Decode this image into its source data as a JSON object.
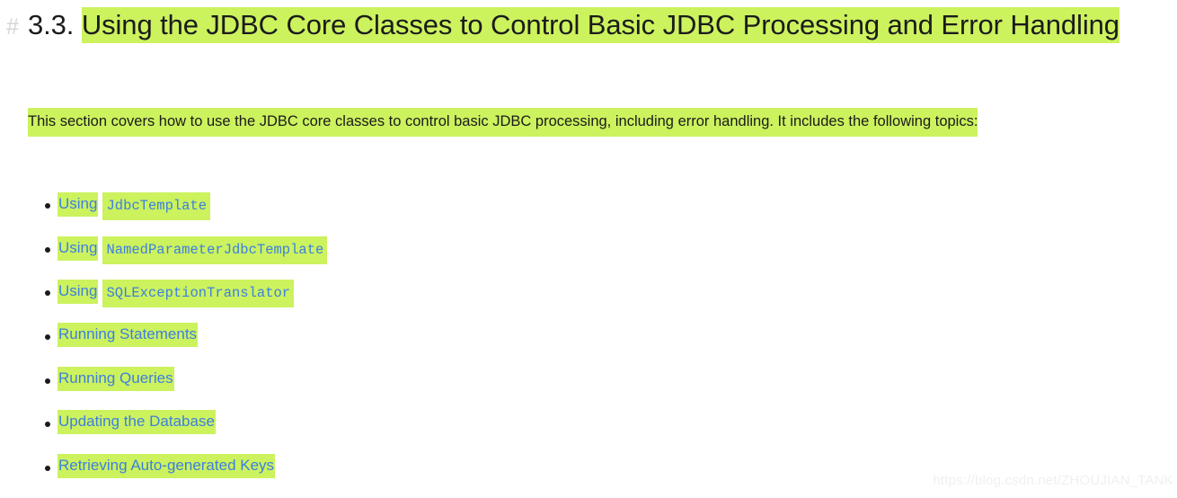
{
  "colors": {
    "highlight": "#ccf25e",
    "link": "#3e7fe0",
    "text": "#1b1b1b",
    "anchor_hash": "#d2d4d6",
    "watermark": "#eff0f1",
    "background": "#ffffff"
  },
  "heading": {
    "anchor_icon": "hash-icon",
    "anchor_glyph": "#",
    "number": "3.3.",
    "title": "Using the JDBC Core Classes to Control Basic JDBC Processing and Error Handling"
  },
  "paragraph": {
    "text": "This section covers how to use the JDBC core classes to control basic JDBC processing, including error handling. It includes the following topics:"
  },
  "topics": [
    {
      "label": "Using",
      "code": "JdbcTemplate"
    },
    {
      "label": "Using",
      "code": "NamedParameterJdbcTemplate"
    },
    {
      "label": "Using",
      "code": "SQLExceptionTranslator"
    },
    {
      "label": "Running Statements",
      "code": ""
    },
    {
      "label": "Running Queries",
      "code": ""
    },
    {
      "label": "Updating the Database",
      "code": ""
    },
    {
      "label": "Retrieving Auto-generated Keys",
      "code": ""
    }
  ],
  "watermark": {
    "text": "https://blog.csdn.net/ZHOUJIAN_TANK"
  }
}
